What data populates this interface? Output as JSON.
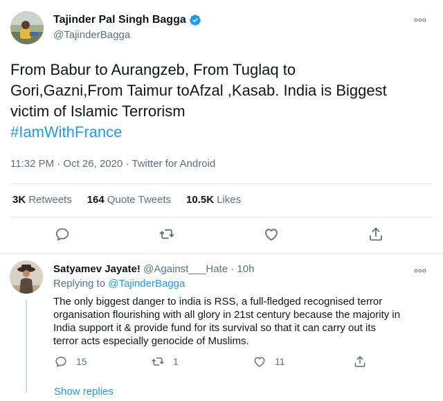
{
  "tweet": {
    "author_name": "Tajinder Pal Singh Bagga",
    "author_handle": "@TajinderBagga",
    "text_line1": "From Babur to Aurangzeb, From Tuglaq to",
    "text_line2": "Gori,Gazni,From Taimur toAfzal ,Kasab. India is Biggest",
    "text_line3": "victim of Islamic Terrorism",
    "hashtag": "#IamWithFrance",
    "meta": "11:32 PM · Oct 26, 2020 · Twitter for Android",
    "retweets_count": "3K",
    "retweets_label": "Retweets",
    "quotes_count": "164",
    "quotes_label": "Quote Tweets",
    "likes_count": "10.5K",
    "likes_label": "Likes"
  },
  "reply": {
    "author_name": "Satyamev Jayate!",
    "author_handle": "@Against___Hate",
    "separator": " · ",
    "time": "10h",
    "replying_prefix": "Replying to ",
    "replying_mention": "@TajinderBagga",
    "text_line1": "The only biggest danger to india is RSS, a full-fledged recognised terror",
    "text_line2": "organisation flourishing with all glory in 21st century because the majority in",
    "text_line3": "India support it & provide fund for its survival so that it can carry out its",
    "text_line4": "terror acts especially genocide of Muslims.",
    "reply_count": "15",
    "retweet_count": "1",
    "like_count": "11"
  },
  "show_replies": "Show replies",
  "colors": {
    "accent": "#1d9bf0",
    "text": "#0f1419",
    "muted": "#5b7083",
    "border": "#e1e8ed"
  },
  "icons": [
    "verified-badge-icon",
    "more-icon",
    "reply-icon",
    "retweet-icon",
    "like-icon",
    "share-icon"
  ]
}
